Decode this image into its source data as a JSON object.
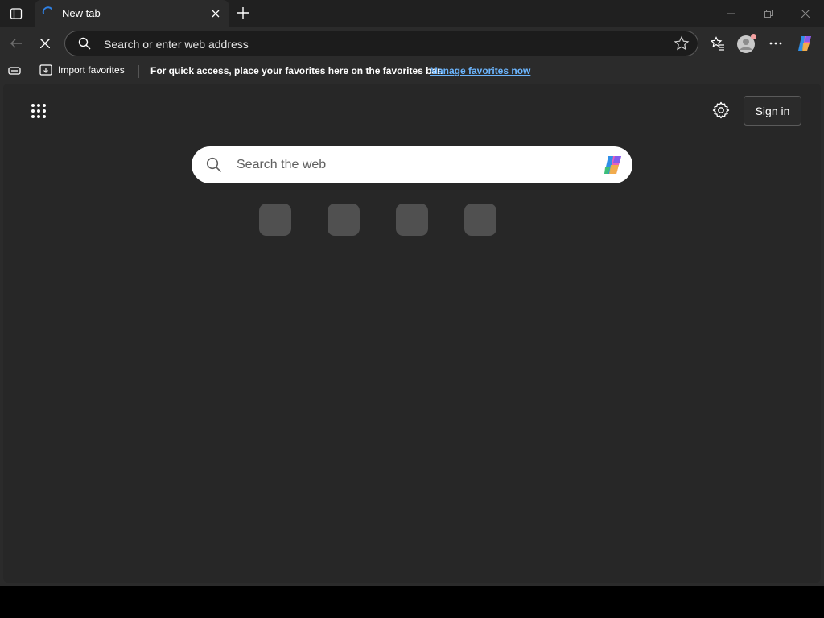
{
  "browser": {
    "tab": {
      "title": "New tab"
    },
    "address_bar": {
      "placeholder": "Search or enter web address"
    }
  },
  "favorites_bar": {
    "import_label": "Import favorites",
    "message": "For quick access, place your favorites here on the favorites bar.",
    "manage_link": "Manage favorites now"
  },
  "new_tab_page": {
    "sign_in_label": "Sign in",
    "search_placeholder": "Search the web",
    "quick_links_count": 4
  },
  "icons": {
    "tab_actions": "tab-actions-icon",
    "favicon": "edge-loading-icon",
    "close_tab": "close-icon",
    "new_tab": "plus-icon",
    "minimize": "minimize-icon",
    "restore": "restore-icon",
    "close_window": "close-icon",
    "back": "back-arrow-icon",
    "stop": "stop-loading-icon",
    "search": "search-icon",
    "favorite_star": "star-icon",
    "favorites": "favorites-icon",
    "profile": "profile-icon",
    "more": "more-icon",
    "copilot": "copilot-icon",
    "apps": "app-launcher-icon",
    "settings": "gear-icon"
  },
  "colors": {
    "frame": "#202020",
    "toolbar": "#2b2b2b",
    "page_background": "#272727",
    "link": "#6cb6ff",
    "search_box": "#ffffff",
    "quick_link_tile": "#505050"
  }
}
